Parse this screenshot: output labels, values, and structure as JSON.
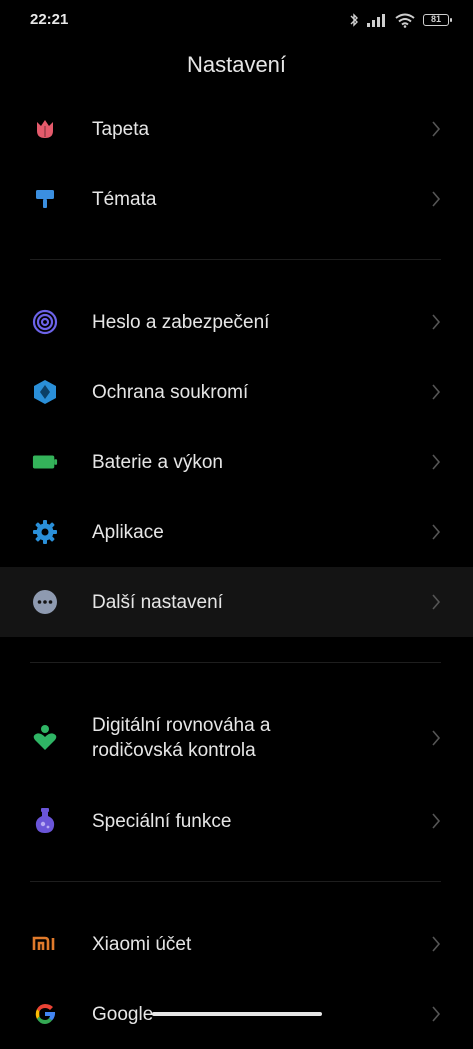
{
  "status_bar": {
    "time": "22:21",
    "battery": "81",
    "icons": [
      "bluetooth-icon",
      "signal-icon",
      "wifi-icon",
      "battery-icon"
    ]
  },
  "header": {
    "title": "Nastavení"
  },
  "items": [
    {
      "label": "Tapeta",
      "icon": "tulip-icon",
      "color": "#e45a6b"
    },
    {
      "label": "Témata",
      "icon": "paint-roller-icon",
      "color": "#3b8fe0"
    },
    {
      "label": "Heslo a zabezpečení",
      "icon": "fingerprint-icon",
      "color": "#6c63e8"
    },
    {
      "label": "Ochrana soukromí",
      "icon": "privacy-shield-icon",
      "color": "#2a8fd8"
    },
    {
      "label": "Baterie a výkon",
      "icon": "battery-icon",
      "color": "#34b35a"
    },
    {
      "label": "Aplikace",
      "icon": "gear-icon",
      "color": "#2a8fd8"
    },
    {
      "label": "Další nastavení",
      "icon": "more-dots-icon",
      "color": "#8e9ab0"
    },
    {
      "label": "Digitální rovnováha a rodičovská kontrola",
      "label_line1": "Digitální rovnováha a",
      "label_line2": "rodičovská kontrola",
      "icon": "digital-wellbeing-icon",
      "color": "#2fb565"
    },
    {
      "label": "Speciální funkce",
      "icon": "special-features-icon",
      "color": "#6a55d8"
    },
    {
      "label": "Xiaomi účet",
      "icon": "mi-logo-icon",
      "color": "#e07a2b"
    },
    {
      "label": "Google",
      "icon": "google-logo-icon",
      "color": "#4285f4"
    }
  ]
}
